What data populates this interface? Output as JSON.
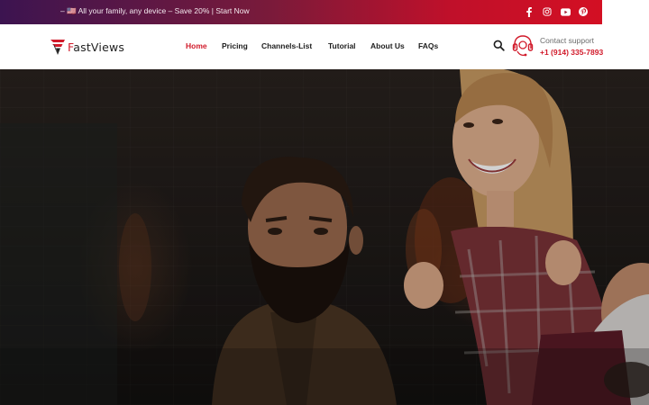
{
  "topbar": {
    "promo_text": "– 🇺🇸 All your family, any device – Save 20% | Start Now",
    "socials": [
      {
        "icon": "facebook-icon"
      },
      {
        "icon": "instagram-icon"
      },
      {
        "icon": "youtube-icon"
      },
      {
        "icon": "pinterest-icon"
      }
    ]
  },
  "header": {
    "logo": {
      "prefix": "F",
      "rest": "astViews"
    },
    "nav": [
      {
        "label": "Home",
        "active": true
      },
      {
        "label": "Pricing",
        "active": false
      },
      {
        "label": "Channels-List",
        "active": false
      },
      {
        "label": "Tutorial",
        "active": false
      },
      {
        "label": "About Us",
        "active": false
      },
      {
        "label": "FAQs",
        "active": false
      }
    ],
    "support": {
      "label": "Contact support",
      "phone": "+1 (914) 335-7893"
    }
  },
  "colors": {
    "accent": "#d11a2a",
    "topbar_start": "#3c1450",
    "topbar_end": "#d30f23",
    "nav_text": "#1d1d1d"
  }
}
